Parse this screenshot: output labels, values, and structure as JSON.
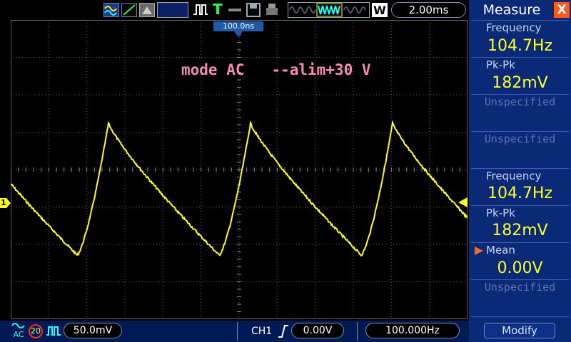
{
  "topbar": {
    "timebase": "2.00ms",
    "trigger_time": "100.0ns",
    "w_label": "W",
    "t_label": "T",
    "icons": [
      "waveform-icon",
      "diagonal-icon",
      "settings-icon",
      "pulse-icon",
      "trigger-t-icon",
      "arrow-icon",
      "save-icon",
      "print-icon",
      "memory-depth-icon",
      "w-icon"
    ]
  },
  "screen": {
    "annotation": "mode AC   --alim+30 V",
    "channel_marker": "1",
    "colors": {
      "trace": "#ffff22",
      "grid": "#5a5a5a",
      "annotation": "#f58cb5"
    }
  },
  "measure_panel": {
    "title": "Measure",
    "close_symbol": "X",
    "items": [
      {
        "label": "Frequency",
        "value": "104.7Hz"
      },
      {
        "label": "Pk-Pk",
        "value": "182mV"
      },
      {
        "unspecified": "Unspecified"
      },
      {
        "unspecified": "Unspecified"
      },
      {
        "label": "Frequency",
        "value": "104.7Hz"
      },
      {
        "label": "Pk-Pk",
        "value": "182mV"
      },
      {
        "label": "Mean",
        "value": "0.00V"
      },
      {
        "unspecified": "Unspecified"
      }
    ],
    "modify_label": "Modify",
    "colors": {
      "bg": "#0a2a78",
      "value": "#ffff22"
    }
  },
  "bottombar": {
    "coupling": "AC",
    "bw_limit": "20",
    "volts_div": "50.0mV",
    "channel": "CH1",
    "trigger_level": "0.00V",
    "trigger_freq": "100.000Hz"
  }
}
